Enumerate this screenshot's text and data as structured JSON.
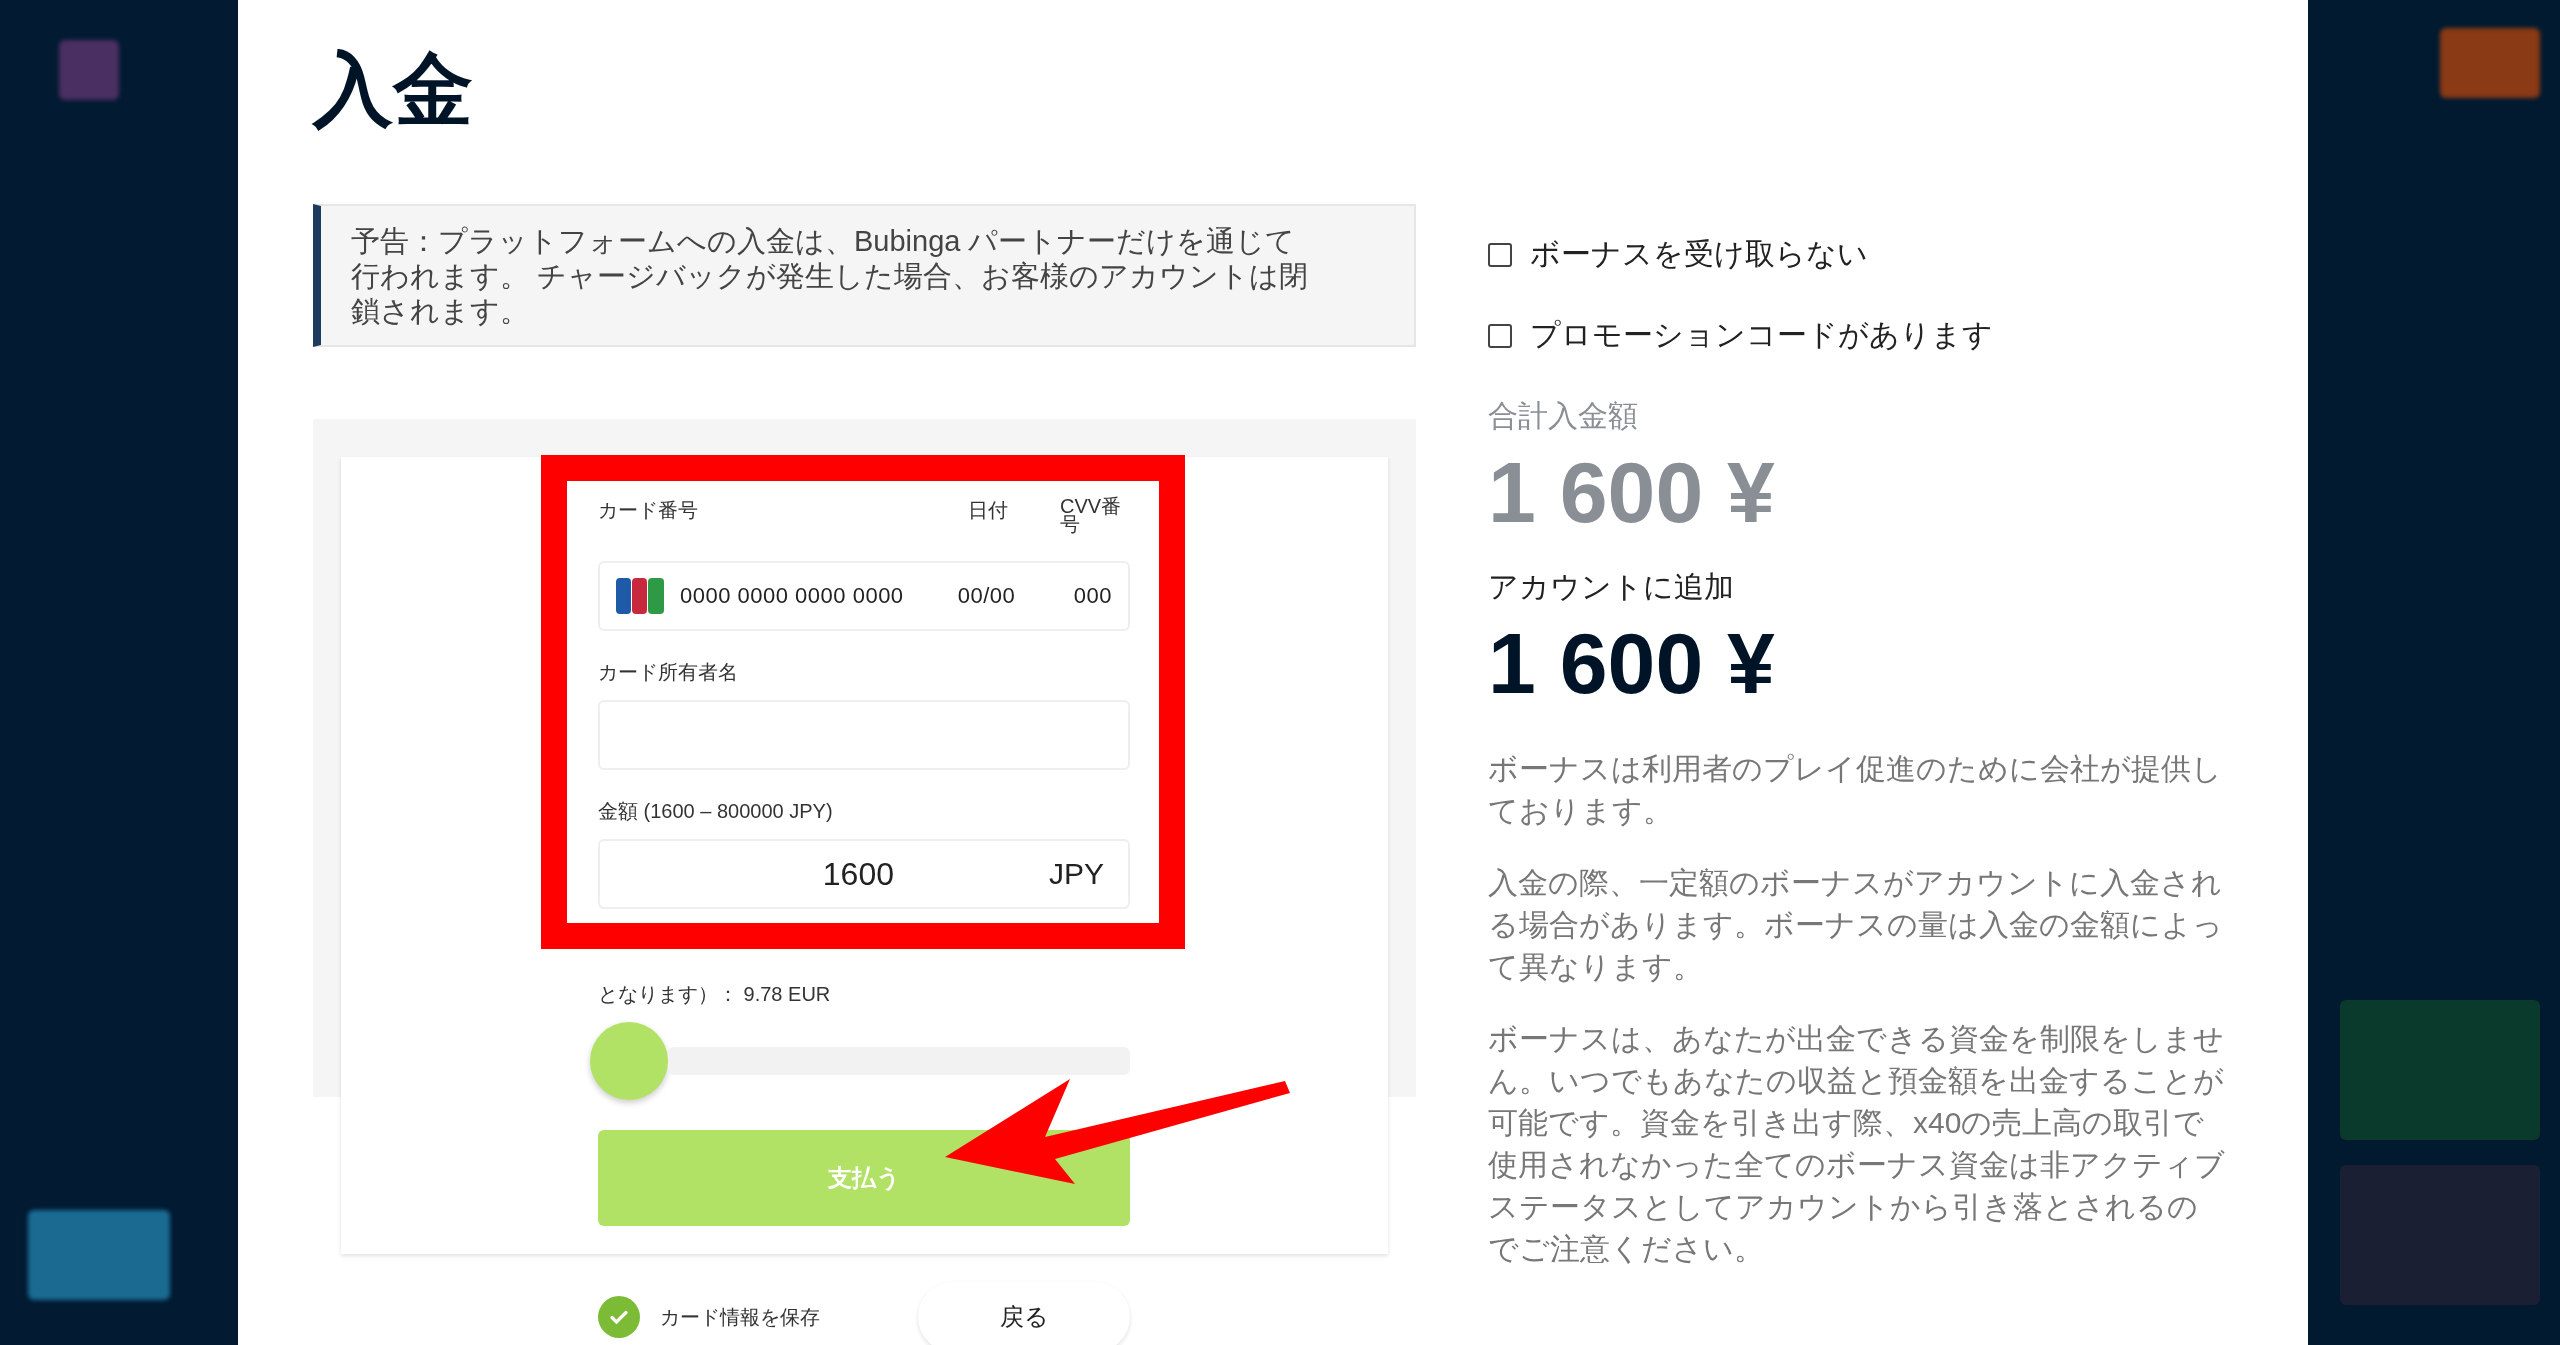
{
  "modal": {
    "title": "入金",
    "notice": "予告：プラットフォームへの入金は、Bubinga パートナーだけを通じて行われます。 チャージバックが発生した場合、お客様のアカウントは閉鎖されます。",
    "card_form": {
      "card_number_label": "カード番号",
      "date_label": "日付",
      "cvv_label": "CVV番号",
      "card_number_placeholder": "0000 0000 0000 0000",
      "date_placeholder": "00/00",
      "cvv_placeholder": "000",
      "holder_label": "カード所有者名",
      "amount_label": "金額 (1600 – 800000 JPY)",
      "amount_value": "1600",
      "amount_currency": "JPY",
      "conversion_text": "となります）： 9.78 EUR",
      "slider": {
        "level": 0
      },
      "pay_button": "支払う"
    },
    "save_card": {
      "label": "カード情報を保存",
      "checked": true
    },
    "back_button": "戻る",
    "options": [
      {
        "label": "ボーナスを受け取らない",
        "checked": false
      },
      {
        "label": "プロモーションコードがあります",
        "checked": false
      }
    ],
    "total_label": "合計入金額",
    "total_value": "1 600 ¥",
    "added_label": "アカウントに追加",
    "added_value": "1 600 ¥",
    "paragraphs": [
      "ボーナスは利用者のプレイ促進のために会社が提供しております。",
      "入金の際、一定額のボーナスがアカウントに入金される場合があります。ボーナスの量は入金の金額によって異なります。",
      "ボーナスは、あなたが出金できる資金を制限をしません。いつでもあなたの収益と預金額を出金することが可能です。資金を引き出す際、x40の売上高の取引で使用されなかった全てのボーナス資金は非アクティブステータスとしてアカウントから引き落とされるのでご注意ください。"
    ]
  }
}
